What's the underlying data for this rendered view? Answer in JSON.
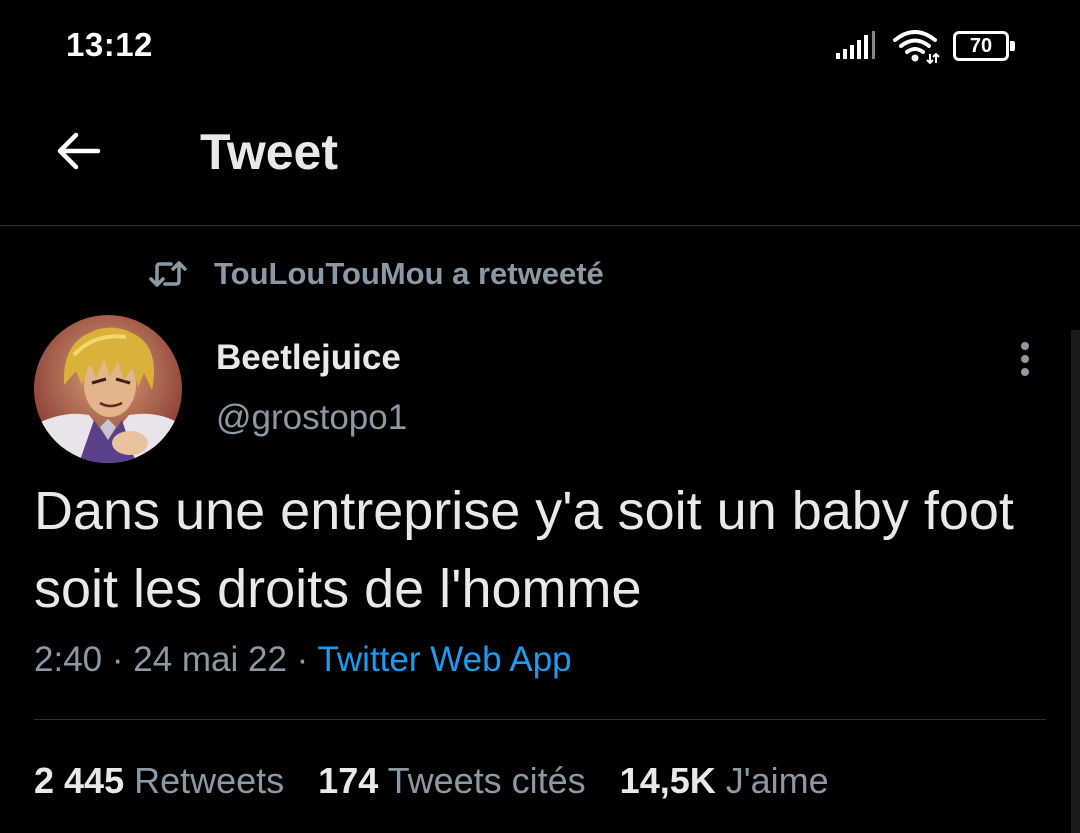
{
  "status_bar": {
    "time": "13:12",
    "battery_level": "70",
    "icons": [
      "signal-icon",
      "wifi-icon",
      "battery-icon"
    ]
  },
  "header": {
    "back_icon": "arrow-left-icon",
    "title": "Tweet"
  },
  "retweet_context": {
    "icon": "retweet-icon",
    "label": "TouLouTouMou a retweeté"
  },
  "tweet": {
    "display_name": "Beetlejuice",
    "handle": "@grostopo1",
    "text": "Dans une entreprise y'a soit un baby foot soit les droits de l'homme",
    "time": "2:40",
    "separator": " · ",
    "date": "24 mai 22",
    "source": "Twitter Web App",
    "more_icon": "more-vertical-icon"
  },
  "stats": {
    "retweets_count": "2 445",
    "retweets_label": " Retweets",
    "quotes_count": "174",
    "quotes_label": " Tweets cités",
    "likes_count": "14,5K",
    "likes_label": " J'aime"
  },
  "colors": {
    "background": "#000000",
    "text_primary": "#e7e9ea",
    "text_secondary": "#8b98a5",
    "link": "#1d9bf0",
    "divider": "#2f3336"
  }
}
